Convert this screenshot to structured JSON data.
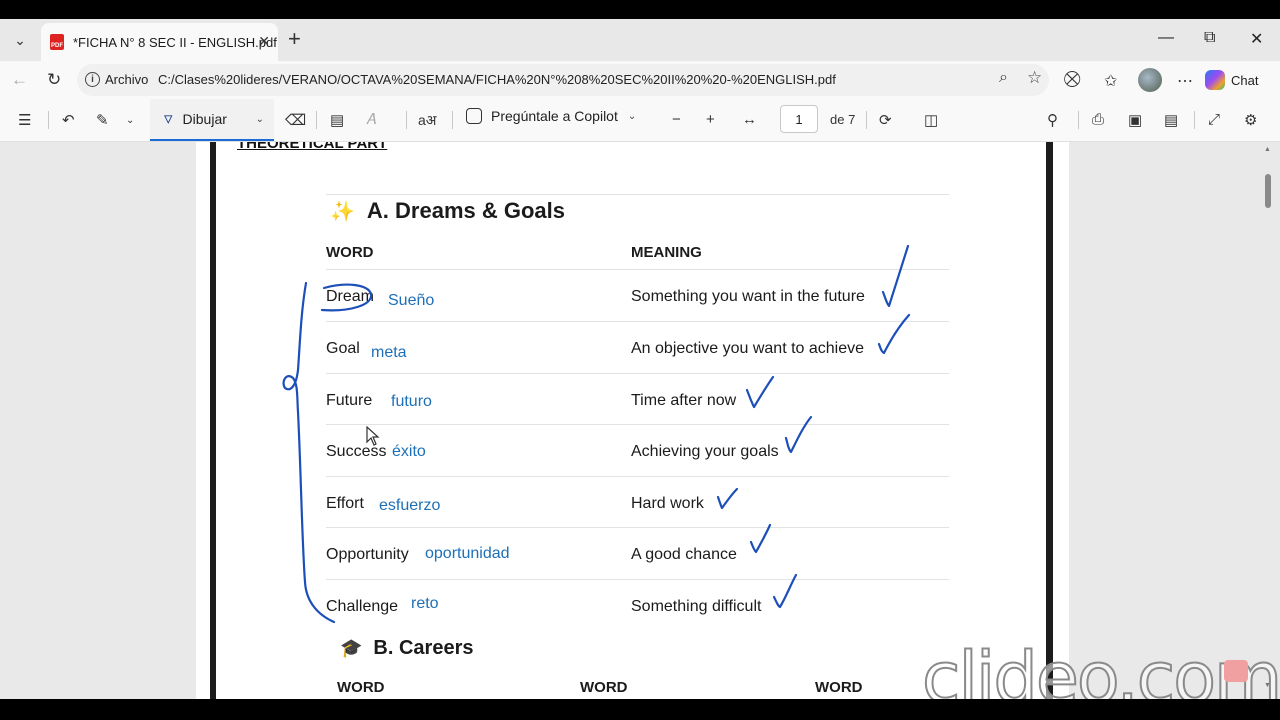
{
  "tab": {
    "title": "*FICHA N° 8 SEC II - ENGLISH.pdf",
    "icon": "pdf-icon"
  },
  "address": {
    "scheme": "Archivo",
    "url": "C:/Clases%20lideres/VERANO/OCTAVA%20SEMANA/FICHA%20N°%208%20SEC%20II%20%20-%20ENGLISH.pdf"
  },
  "chat_label": "Chat",
  "pdf_toolbar": {
    "draw_label": "Dibujar",
    "copilot_label": "Pregúntale a Copilot",
    "page_number": "1",
    "page_count": "de 7"
  },
  "document": {
    "theory_heading": "THEORETICAL PART",
    "section_a": {
      "title": "A. Dreams & Goals",
      "col_word": "WORD",
      "col_meaning": "MEANING",
      "rows": [
        {
          "word": "Dream",
          "translation": "Sueño",
          "meaning": "Something you want in the future"
        },
        {
          "word": "Goal",
          "translation": "meta",
          "meaning": "An objective you want to achieve"
        },
        {
          "word": "Future",
          "translation": "futuro",
          "meaning": "Time after now"
        },
        {
          "word": "Success",
          "translation": "éxito",
          "meaning": "Achieving your goals"
        },
        {
          "word": "Effort",
          "translation": "esfuerzo",
          "meaning": "Hard work"
        },
        {
          "word": "Opportunity",
          "translation": "oportunidad",
          "meaning": "A good chance"
        },
        {
          "word": "Challenge",
          "translation": "reto",
          "meaning": "Something difficult"
        }
      ]
    },
    "section_b": {
      "title": "B. Careers",
      "cols": [
        "WORD",
        "WORD",
        "WORD"
      ]
    }
  },
  "watermark": "clideo.com",
  "colors": {
    "ink": "#1d4fb8",
    "translation": "#1d6fb8",
    "accent": "#1a6bd6"
  }
}
